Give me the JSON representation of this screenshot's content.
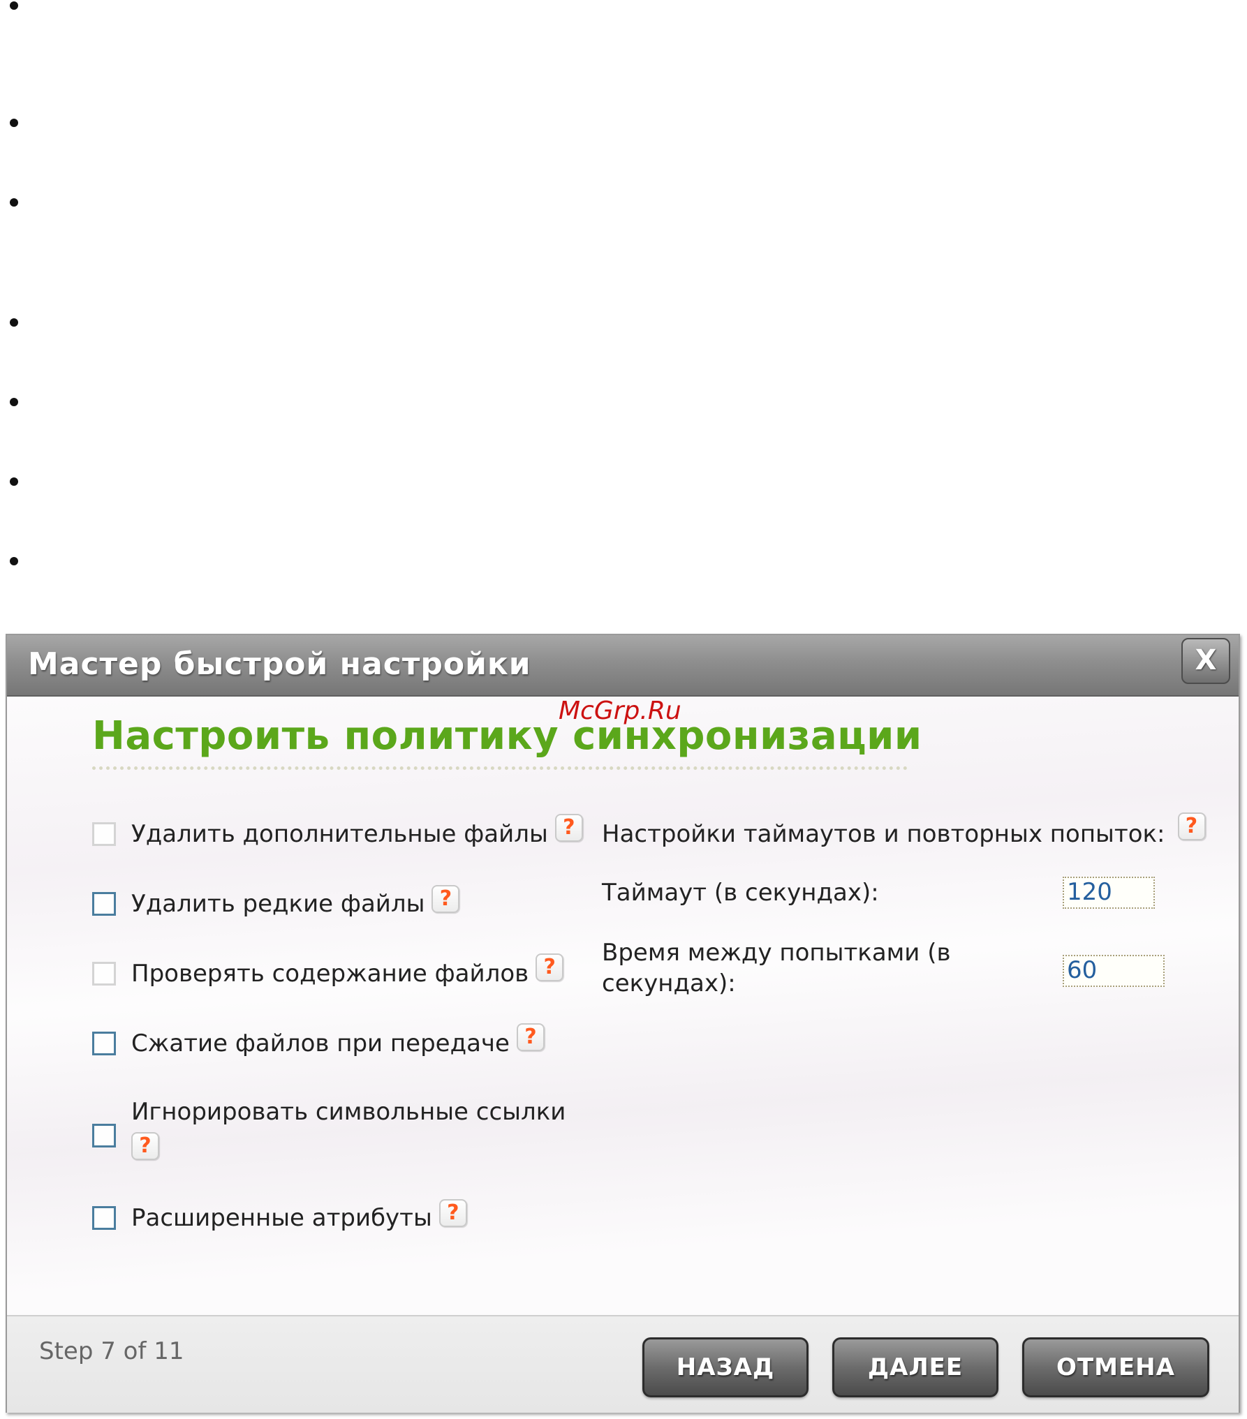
{
  "dialog": {
    "title": "Мастер быстрой настройки",
    "close_label": "X"
  },
  "watermark": "McGrp.Ru",
  "heading": "Настроить политику синхронизации",
  "options": [
    {
      "label": "Удалить дополнительные файлы",
      "help": "?"
    },
    {
      "label": "Удалить редкие файлы",
      "help": "?"
    },
    {
      "label": "Проверять содержание файлов",
      "help": "?"
    },
    {
      "label": "Сжатие файлов при передаче",
      "help": "?"
    },
    {
      "label": "Игнорировать символьные ссылки",
      "help": "?"
    },
    {
      "label": "Расширенные атрибуты",
      "help": "?"
    }
  ],
  "timeouts": {
    "section_label": "Настройки таймаутов и повторных попыток:",
    "help": "?",
    "timeout_label": "Таймаут (в секундах):",
    "timeout_value": "120",
    "retry_label_line1": "Время между попытками (в",
    "retry_label_line2": "секундах):",
    "retry_value": "60"
  },
  "footer": {
    "step": "Step 7 of 11",
    "back": "НАЗАД",
    "next": "ДАЛЕЕ",
    "cancel": "ОТМЕНА"
  },
  "colors": {
    "heading": "#5ba71b",
    "help_mark": "#ff5a1e",
    "field_text": "#245f9e",
    "watermark": "#cc1111"
  }
}
